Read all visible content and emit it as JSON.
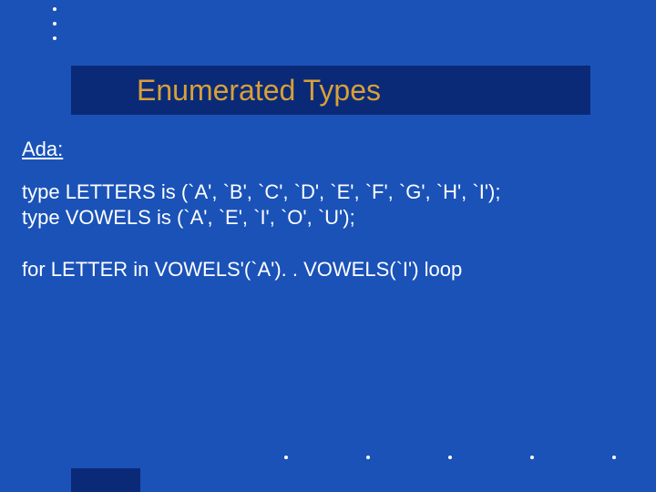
{
  "title": "Enumerated Types",
  "language_label": "Ada:",
  "code_line1": "type LETTERS is (`A', `B', `C', `D', `E', `F', `G', `H', `I');",
  "code_line2": "type VOWELS is (`A', `E', `I', `O', `U');",
  "code_line3": "for LETTER in VOWELS'(`A'). . VOWELS(`I') loop"
}
